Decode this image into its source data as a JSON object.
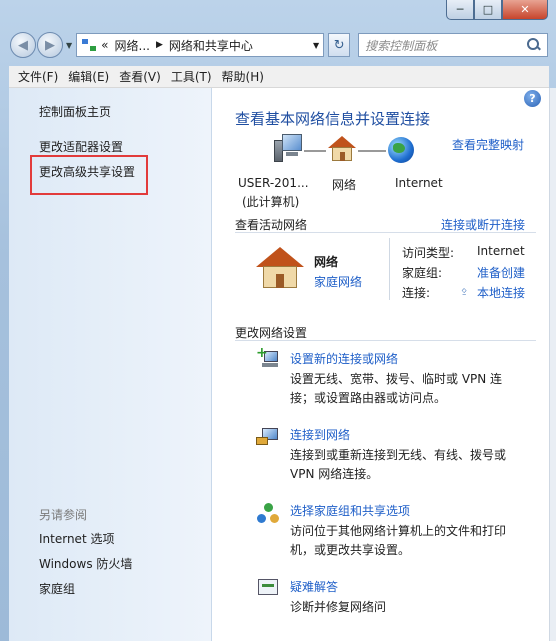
{
  "window": {
    "minimize_glyph": "─",
    "maximize_glyph": "□",
    "close_glyph": "✕"
  },
  "address": {
    "crumb_overflow": "«",
    "crumb_parent": "网络...",
    "crumb_current": "网络和共享中心",
    "search_placeholder": "搜索控制面板"
  },
  "menu": [
    "文件(F)",
    "编辑(E)",
    "查看(V)",
    "工具(T)",
    "帮助(H)"
  ],
  "sidebar": {
    "links": [
      "控制面板主页",
      "更改适配器设置",
      "更改高级共享设置"
    ],
    "see_also_header": "另请参阅",
    "see_also": [
      "Internet 选项",
      "Windows 防火墙",
      "家庭组"
    ]
  },
  "main": {
    "help_glyph": "?",
    "title": "查看基本网络信息并设置连接",
    "full_map_link": "查看完整映射",
    "map": {
      "computer_label_1": "USER-201...",
      "computer_label_2": "(此计算机)",
      "network_label": "网络",
      "internet_label": "Internet"
    },
    "active_header": "查看活动网络",
    "connect_disconnect_link": "连接或断开连接",
    "active_network": {
      "name": "网络",
      "type_link": "家庭网络",
      "access_type_label": "访问类型:",
      "access_type_value": "Internet",
      "homegroup_label": "家庭组:",
      "homegroup_value": "准备创建",
      "connection_label": "连接:",
      "connection_value": "本地连接"
    },
    "change_header": "更改网络设置",
    "tasks": [
      {
        "title": "设置新的连接或网络",
        "desc": "设置无线、宽带、拨号、临时或 VPN 连接；或设置路由器或访问点。"
      },
      {
        "title": "连接到网络",
        "desc": "连接到或重新连接到无线、有线、拨号或 VPN 网络连接。"
      },
      {
        "title": "选择家庭组和共享选项",
        "desc": "访问位于其他网络计算机上的文件和打印机，或更改共享设置。"
      },
      {
        "title": "疑难解答",
        "desc": "诊断并修复网络问"
      }
    ]
  },
  "icons": {
    "back": "arrow-left-icon",
    "forward": "arrow-right-icon",
    "refresh": "refresh-icon",
    "search": "search-icon",
    "help": "help-icon"
  },
  "colors": {
    "link": "#1f5fc8",
    "title": "#1f4ea1",
    "highlight_box": "#e23b3b"
  }
}
